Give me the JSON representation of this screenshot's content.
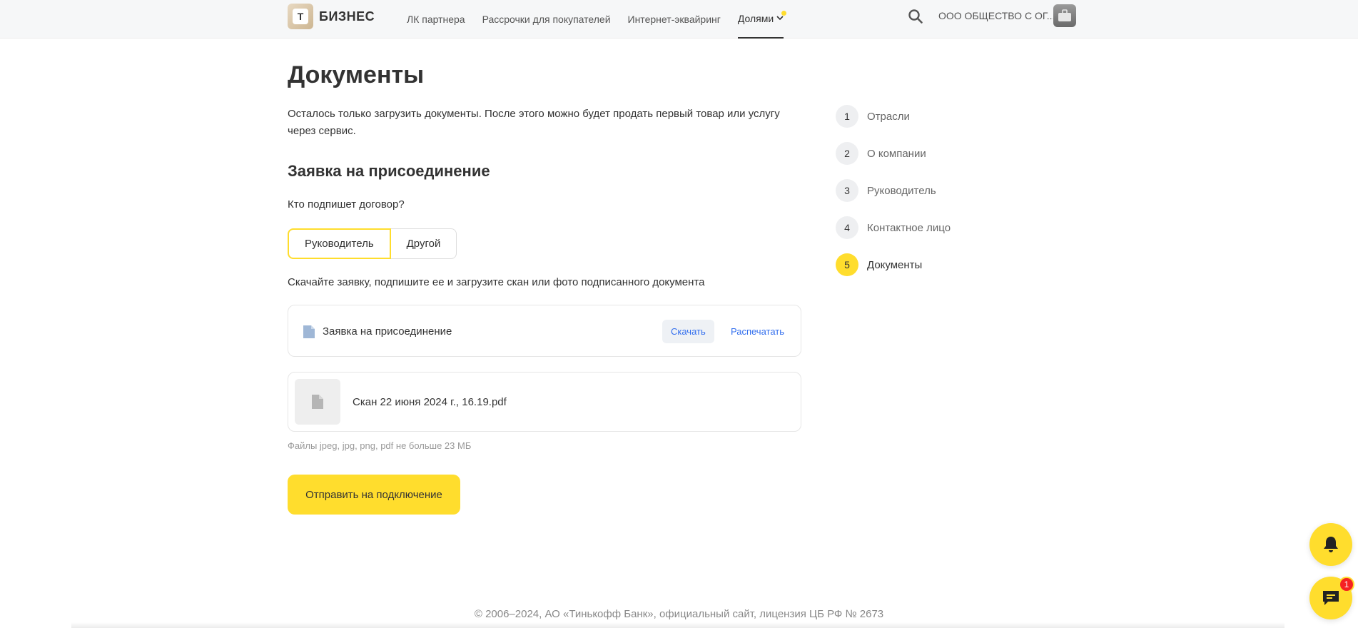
{
  "header": {
    "logo_text": "БИЗНЕС",
    "logo_mark": "Т",
    "nav": [
      {
        "label": "ЛК партнера"
      },
      {
        "label": "Рассрочки для покупателей"
      },
      {
        "label": "Интернет-эквайринг"
      },
      {
        "label": "Долями"
      }
    ],
    "company": "ООО ОБЩЕСТВО С ОГ..."
  },
  "main": {
    "title": "Документы",
    "intro": "Осталось только загрузить документы. После этого можно будет продать первый товар или услугу через сервис.",
    "section_title": "Заявка на присоединение",
    "question": "Кто подпишет договор?",
    "signer_options": [
      "Руководитель",
      "Другой"
    ],
    "signer_selected": "Руководитель",
    "instruction": "Скачайте заявку, подпишите ее и загрузите скан или фото подписанного документа",
    "document": {
      "name": "Заявка на присоединение",
      "download_label": "Скачать",
      "print_label": "Распечатать"
    },
    "uploaded_file": {
      "name": "Скан 22 июня 2024 г., 16.19.pdf"
    },
    "hint": "Файлы jpeg, jpg, png, pdf не больше 23 МБ",
    "submit_label": "Отправить на подключение"
  },
  "stepper": {
    "current": 5,
    "steps": [
      {
        "num": "1",
        "label": "Отрасли"
      },
      {
        "num": "2",
        "label": "О компании"
      },
      {
        "num": "3",
        "label": "Руководитель"
      },
      {
        "num": "4",
        "label": "Контактное лицо"
      },
      {
        "num": "5",
        "label": "Документы"
      }
    ]
  },
  "footer": {
    "text": "© 2006–2024, АО «Тинькофф Банк», официальный сайт, лицензия ЦБ РФ № 2673"
  },
  "floating": {
    "chat_badge": "1"
  },
  "colors": {
    "accent": "#ffdd2d",
    "link": "#336fee",
    "badge": "#f52222"
  },
  "icons": [
    "search-icon",
    "chevron-down-icon",
    "document-icon",
    "file-icon",
    "bell-icon",
    "chat-icon"
  ]
}
